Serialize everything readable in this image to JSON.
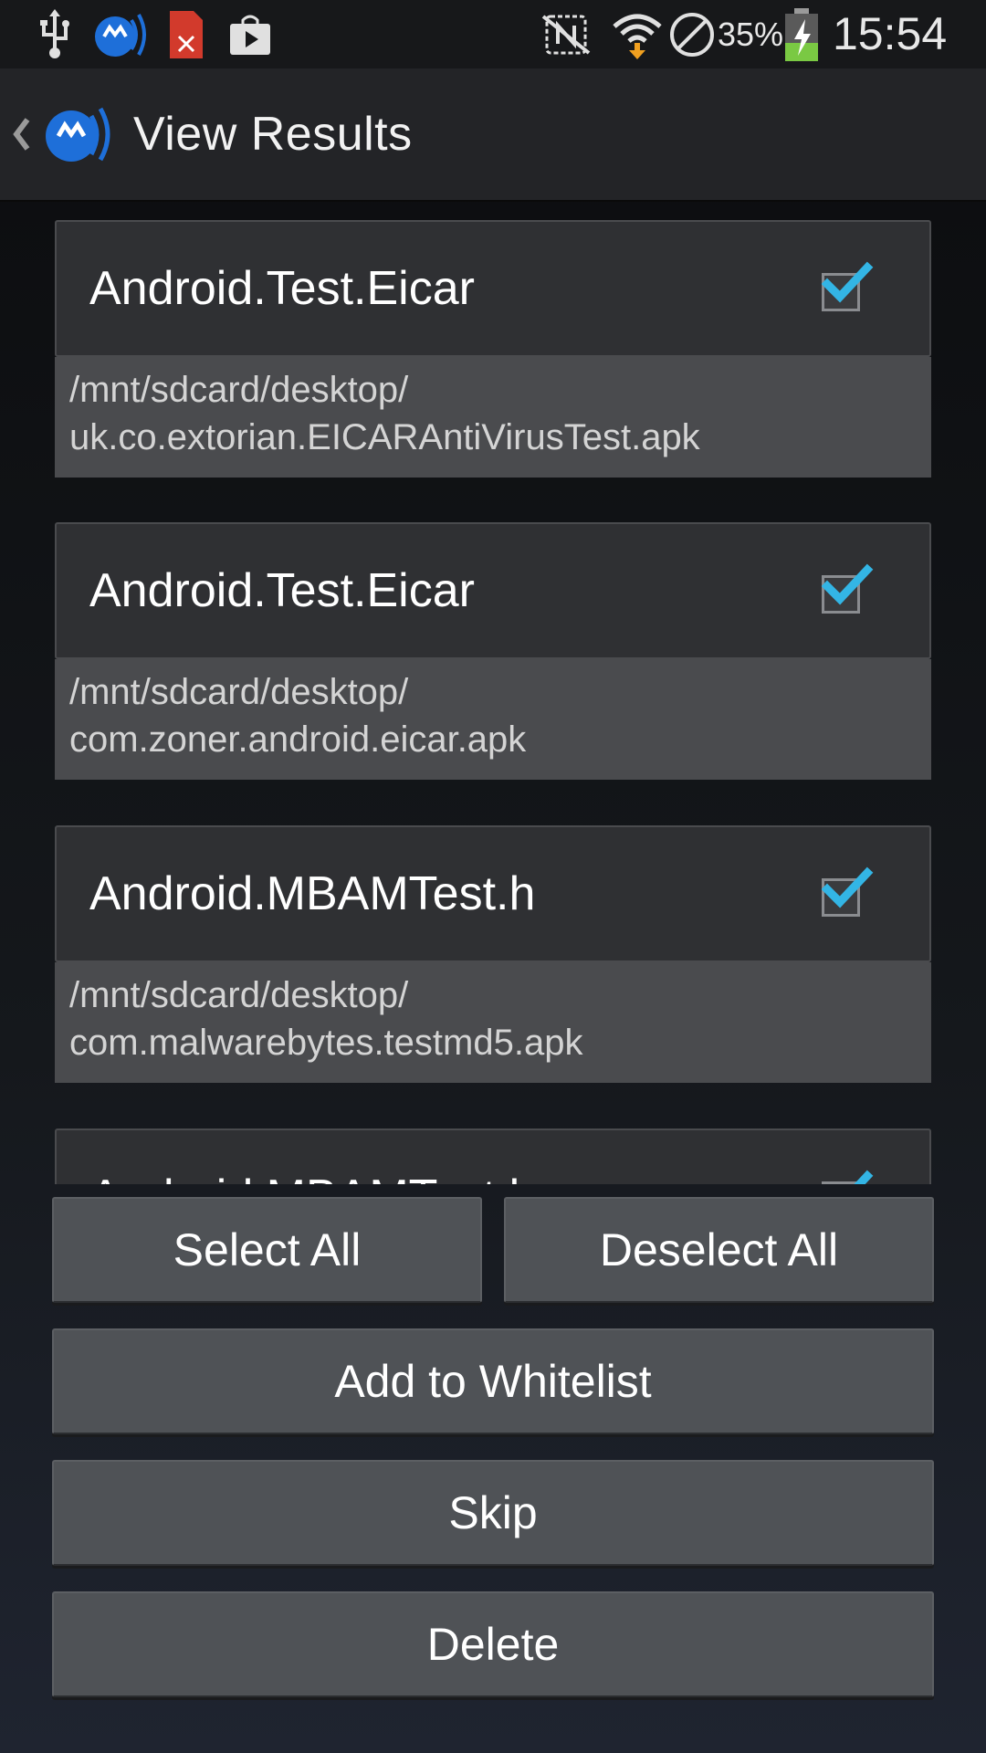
{
  "status_bar": {
    "icons": [
      "usb-icon",
      "malwarebytes-icon",
      "file-error-icon",
      "play-store-icon",
      "no-nfc-icon",
      "wifi-icon",
      "blocked-icon",
      "battery-charging-icon"
    ],
    "battery_percent": "35%",
    "time": "15:54"
  },
  "action_bar": {
    "title": "View Results"
  },
  "results": [
    {
      "name": "Android.Test.Eicar",
      "checked": true,
      "path_line1": "/mnt/sdcard/desktop/",
      "path_line2": "uk.co.extorian.EICARAntiVirusTest.apk"
    },
    {
      "name": "Android.Test.Eicar",
      "checked": true,
      "path_line1": "/mnt/sdcard/desktop/",
      "path_line2": "com.zoner.android.eicar.apk"
    },
    {
      "name": "Android.MBAMTest.h",
      "checked": true,
      "path_line1": "/mnt/sdcard/desktop/",
      "path_line2": "com.malwarebytes.testmd5.apk"
    },
    {
      "name": "Android.MBAMTest.h",
      "checked": true,
      "path_line1": "",
      "path_line2": ""
    }
  ],
  "buttons": {
    "select_all": "Select All",
    "deselect_all": "Deselect All",
    "add_to_whitelist": "Add to Whitelist",
    "skip": "Skip",
    "delete": "Delete"
  },
  "colors": {
    "check_accent": "#33b5e5",
    "logo_blue": "#1e6fd9",
    "battery_green": "#7ac943"
  }
}
